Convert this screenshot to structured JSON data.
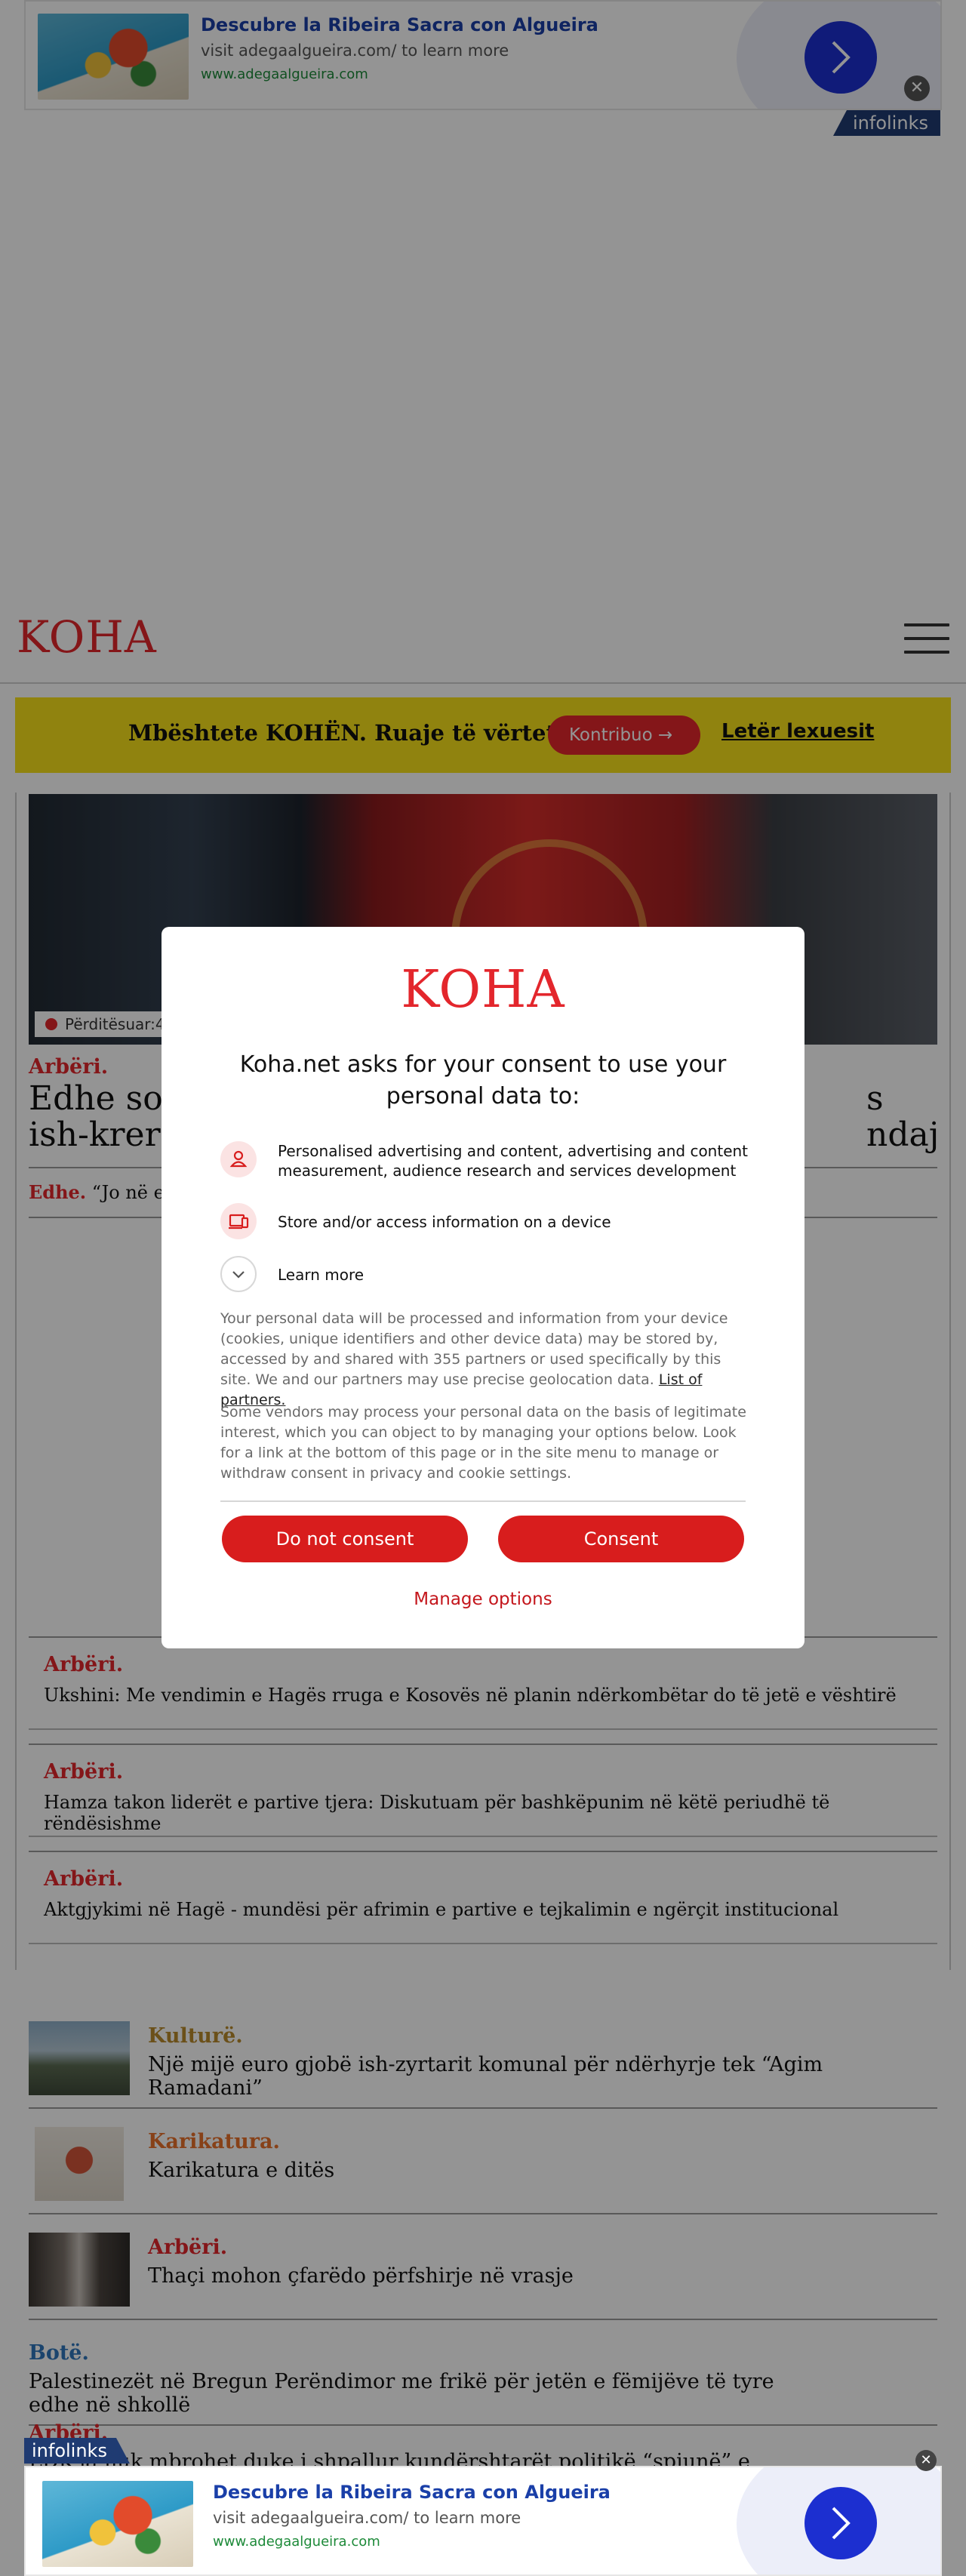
{
  "ad_top": {
    "title": "Descubre la Ribeira Sacra con Algueira",
    "subtitle": "visit adegaalgueira.com/ to learn more",
    "url": "www.adegaalgueira.com",
    "close": "✕",
    "badge": "infolinks"
  },
  "header": {
    "logo": "KOHA"
  },
  "support": {
    "text": "Mbështete KOHËN. Ruaje të vërtetën",
    "button": "Kontribuo →",
    "link": "Letër lexuesit"
  },
  "main_article": {
    "updated": "Përditësuar:4",
    "kicker": "Arbëri.",
    "title_left": "Edhe sot",
    "title_right": "s ndaj",
    "title_line2": "ish-krerë",
    "lead_kicker": "Edhe.",
    "lead_text": "“Jo në em"
  },
  "related": [
    {
      "kicker": "Arbëri.",
      "title": "Ukshini: Me vendimin e Hagës rruga e Kosovës në planin ndërkombëtar do të jetë e vështirë"
    },
    {
      "kicker": "Arbëri.",
      "title": "Hamza takon liderët e partive tjera: Diskutuam për bashkëpunim në këtë periudhë të rëndësishme"
    },
    {
      "kicker": "Arbëri.",
      "title": "Aktgjykimi në Hagë - mundësi për afrimin e partive e tejkalimin e ngërçit institucional"
    }
  ],
  "cards": [
    {
      "kicker": "Kulturë.",
      "title": "Një mijë euro gjobë ish-zyrtarit komunal për ndërhyrje tek “Agim Ramadani”"
    },
    {
      "kicker": "Karikatura.",
      "title": "Karikatura e ditës"
    },
    {
      "kicker": "Arbëri.",
      "title": "Thaçi mohon çfarëdo përfshirje në vrasje"
    },
    {
      "kicker": "Botë.",
      "title": "Palestinezët në Bregun Perëndimor me frikë për jetën e fëmijëve të tyre edhe në shkollë"
    },
    {
      "kicker": "Arbëri.",
      "title": "LDK-ja nuk mbrohet duke i shpallur kundërshtarët politikë “spiunë” e “tradhtarë”"
    }
  ],
  "consent": {
    "logo": "KOHA",
    "heading": "Koha.net asks for your consent to use your personal data to:",
    "purposes": [
      "Personalised advertising and content, advertising and content measurement, audience research and services development",
      "Store and/or access information on a device",
      "Learn more"
    ],
    "paragraph1": "Your personal data will be processed and information from your device (cookies, unique identifiers and other device data) may be stored by, accessed by and shared with 355 partners or used specifically by this site. We and our partners may use precise geolocation data.",
    "partners_link": "List of partners.",
    "paragraph2": "Some vendors may process your personal data on the basis of legitimate interest, which you can object to by managing your options below. Look for a link at the bottom of this page or in the site menu to manage or withdraw consent in privacy and cookie settings.",
    "do_not_consent": "Do not consent",
    "consent": "Consent",
    "manage": "Manage options"
  },
  "ad_bottom": {
    "title": "Descubre la Ribeira Sacra con Algueira",
    "subtitle": "visit adegaalgueira.com/ to learn more",
    "url": "www.adegaalgueira.com",
    "close": "✕",
    "badge": "infolinks"
  },
  "colors": {
    "brand_red": "#e3262c",
    "support_yellow": "#f8e21a",
    "consent_red": "#d81d1d",
    "ad_blue": "#1c2fd0"
  },
  "icons": [
    "person-icon",
    "device-icon",
    "chevron-down-icon",
    "arrow-right-icon",
    "close-icon",
    "menu-icon"
  ]
}
